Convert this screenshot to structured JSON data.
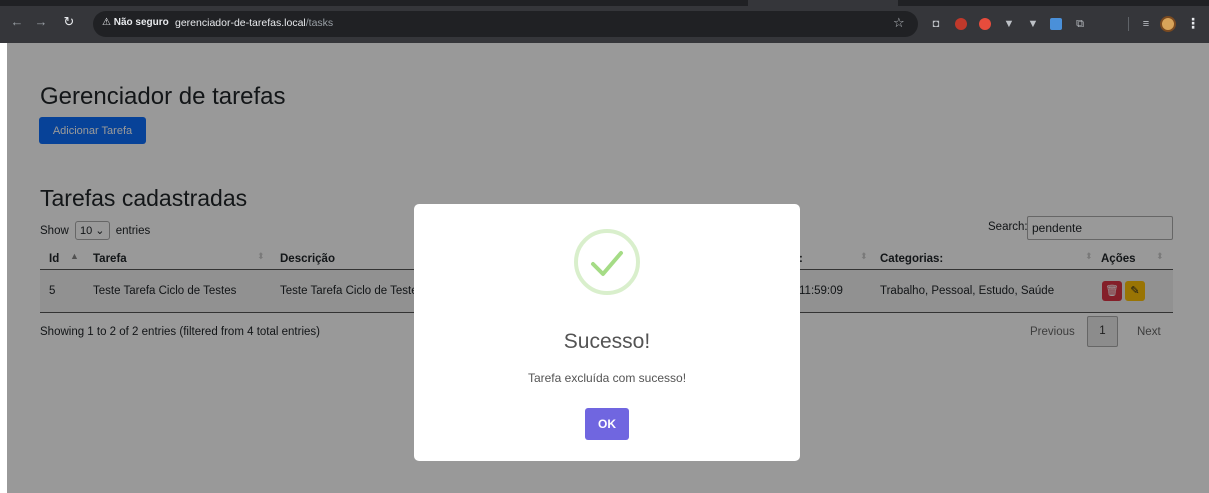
{
  "browser": {
    "insecure_label": "⚠ Não seguro",
    "url_host": "gerenciador-de-tarefas.local",
    "url_path": "/tasks"
  },
  "page": {
    "title": "Gerenciador de tarefas",
    "add_button": "Adicionar Tarefa",
    "list_title": "Tarefas cadastradas",
    "show_label": "Show",
    "entries_value": "10",
    "entries_label": "entries",
    "search_label": "Search:",
    "search_value": "pendente",
    "columns": {
      "id": "Id",
      "task": "Tarefa",
      "description": "Descrição",
      "date_partial": ":",
      "categories": "Categorias:",
      "actions": "Ações"
    },
    "row": {
      "id": "5",
      "task": "Teste Tarefa Ciclo de Testes",
      "description": "Teste Tarefa Ciclo de Teste",
      "time_partial": "11:59:09",
      "categories": "Trabalho, Pessoal, Estudo, Saúde"
    },
    "info": "Showing 1 to 2 of 2 entries (filtered from 4 total entries)",
    "pagination": {
      "previous": "Previous",
      "page": "1",
      "next": "Next"
    }
  },
  "modal": {
    "title": "Sucesso!",
    "text": "Tarefa excluída com sucesso!",
    "ok_label": "OK"
  },
  "colors": {
    "primary": "#0d6efd",
    "danger": "#dc3545",
    "warning": "#ffc107",
    "swal_confirm": "#7066e0",
    "success_check": "#a5dc86"
  }
}
